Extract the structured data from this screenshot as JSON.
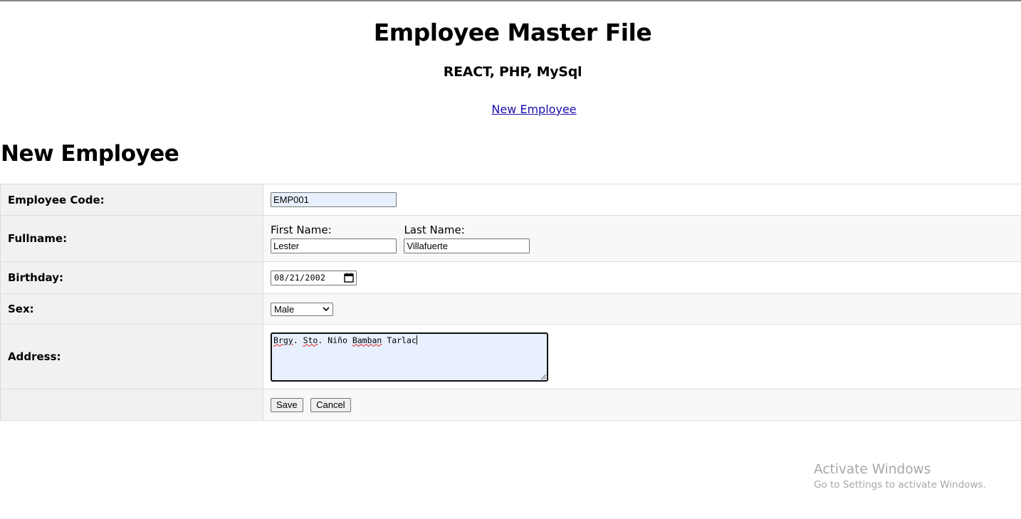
{
  "site": {
    "title": "Employee Master File",
    "subtitle": "REACT, PHP, MySql",
    "nav_link": "New Employee"
  },
  "page": {
    "heading": "New Employee"
  },
  "form": {
    "employee_code": {
      "label": "Employee Code:",
      "value": "EMP001"
    },
    "fullname": {
      "label": "Fullname:",
      "first_name_label": "First Name:",
      "first_name_value": "Lester",
      "last_name_label": "Last Name:",
      "last_name_value": "Villafuerte"
    },
    "birthday": {
      "label": "Birthday:",
      "value": "08/21/2002"
    },
    "sex": {
      "label": "Sex:",
      "selected": "Male"
    },
    "address": {
      "label": "Address:",
      "value_parts": [
        "Brgy",
        ". ",
        "Sto",
        ". Niño ",
        "Bamban",
        " Tarlac"
      ]
    },
    "actions": {
      "save_label": "Save",
      "cancel_label": "Cancel"
    }
  },
  "watermark": {
    "title": "Activate Windows",
    "subtitle": "Go to Settings to activate Windows."
  },
  "icons": {
    "calendar": "calendar-icon",
    "dropdown": "chevron-down-icon"
  }
}
